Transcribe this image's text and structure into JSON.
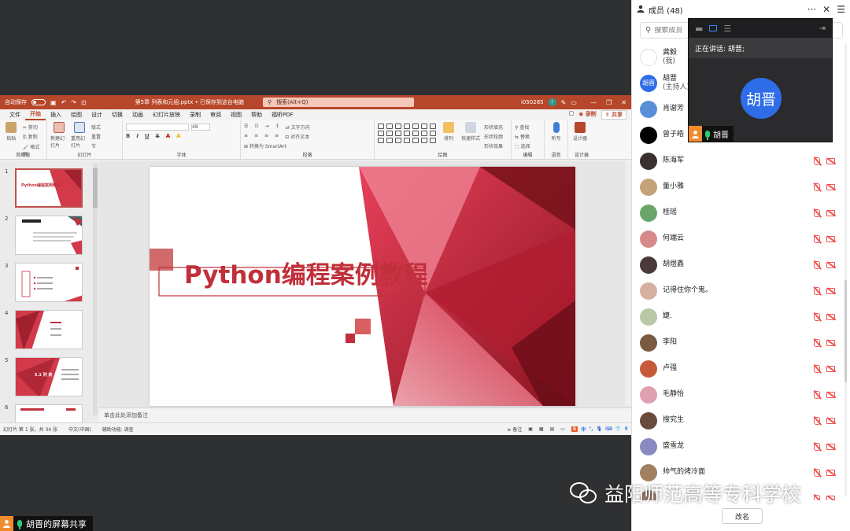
{
  "ppt": {
    "autosave": "自动保存",
    "filename": "第5章 列表和元组.pptx • 已保存到这台电脑",
    "search": "搜索(Alt+Q)",
    "user": "i050285",
    "menu": [
      "文件",
      "开始",
      "插入",
      "绘图",
      "设计",
      "切换",
      "动画",
      "幻灯片放映",
      "录制",
      "审阅",
      "视图",
      "帮助",
      "福昕PDF"
    ],
    "active_tab": "开始",
    "record": "录制",
    "share": "共享",
    "ribbon_groups": [
      "剪贴板",
      "幻灯片",
      "字体",
      "段落",
      "绘图",
      "编辑",
      "语音",
      "设计器"
    ],
    "ribbon_items": {
      "paste": "粘贴",
      "cut": "剪切",
      "copy": "复制",
      "format_painter": "格式刷",
      "new_slide": "新建幻灯片",
      "reuse_slide": "重用幻灯片",
      "layout": "版式",
      "reset": "重置",
      "section": "节",
      "text_direction": "文字方向",
      "align_text": "对齐文本",
      "smartart": "转换为 SmartArt",
      "arrange": "排列",
      "quick_styles": "快速样式",
      "shape_fill": "形状填充",
      "shape_outline": "形状轮廓",
      "shape_effect": "形状效果",
      "find": "查找",
      "replace": "替换",
      "select": "选择",
      "dictate": "听写",
      "designer": "设计器"
    },
    "font_size": "48",
    "thumb_numbers": [
      "1",
      "2",
      "3",
      "4",
      "5",
      "6"
    ],
    "thumb_titles": [
      "Python编程案例教程",
      "",
      "",
      "",
      "5.1 列 表",
      ""
    ],
    "slide_title": "Python编程案例教程",
    "notes": "单击此处添加备注",
    "status": {
      "slide_info": "幻灯片 第 1 张，共 34 张",
      "lang": "中文(中国)",
      "accessibility": "辅助功能: 调查",
      "notes_btn": "备注",
      "ime_s": "S",
      "ime_text": "中"
    }
  },
  "screen_share_label": "胡晋的屏幕共享",
  "members": {
    "title": "成员 (48)",
    "search_placeholder": "搜索成员",
    "list": [
      {
        "name": "龚毅",
        "sub": "(我)",
        "avatar_color": "#ffffff",
        "avatar_text": "",
        "muted": false
      },
      {
        "name": "胡晋",
        "sub": "(主持人)",
        "avatar_color": "#2f6de8",
        "avatar_text": "胡晋",
        "muted": false
      },
      {
        "name": "肖谢芳",
        "sub": "",
        "avatar_color": "#5a8fd8",
        "avatar_text": "",
        "muted": false
      },
      {
        "name": "曾子皓",
        "sub": "",
        "avatar_color": "#000000",
        "avatar_text": "",
        "muted": false
      },
      {
        "name": "陈海军",
        "sub": "",
        "avatar_color": "#3b3030",
        "avatar_text": "",
        "muted": true
      },
      {
        "name": "董小雅",
        "sub": "",
        "avatar_color": "#c4a27a",
        "avatar_text": "",
        "muted": true
      },
      {
        "name": "桂瑶",
        "sub": "",
        "avatar_color": "#6aa56a",
        "avatar_text": "",
        "muted": true
      },
      {
        "name": "何端云",
        "sub": "",
        "avatar_color": "#d88a8a",
        "avatar_text": "",
        "muted": true
      },
      {
        "name": "胡煜鑫",
        "sub": "",
        "avatar_color": "#4a3a3a",
        "avatar_text": "",
        "muted": true
      },
      {
        "name": "记得住你个鬼。",
        "sub": "",
        "avatar_color": "#d6b0a0",
        "avatar_text": "",
        "muted": true
      },
      {
        "name": "婕.",
        "sub": "",
        "avatar_color": "#b9c9a8",
        "avatar_text": "",
        "muted": true
      },
      {
        "name": "李阳",
        "sub": "",
        "avatar_color": "#7a5a40",
        "avatar_text": "",
        "muted": true
      },
      {
        "name": "卢强",
        "sub": "",
        "avatar_color": "#c55a3a",
        "avatar_text": "",
        "muted": true
      },
      {
        "name": "毛静怡",
        "sub": "",
        "avatar_color": "#e0a0b0",
        "avatar_text": "",
        "muted": true
      },
      {
        "name": "搜究生",
        "sub": "",
        "avatar_color": "#6a4a3a",
        "avatar_text": "",
        "muted": true
      },
      {
        "name": "盛雪龙",
        "sub": "",
        "avatar_color": "#8a8ac0",
        "avatar_text": "",
        "muted": true
      },
      {
        "name": "帅气的烤冷面",
        "sub": "",
        "avatar_color": "#a08060",
        "avatar_text": "",
        "muted": true
      },
      {
        "name": "",
        "sub": "",
        "avatar_color": "#9a7a6a",
        "avatar_text": "",
        "muted": true
      }
    ],
    "rename": "改名"
  },
  "speaker": {
    "talking": "正在讲话: 胡晋;",
    "avatar_text": "胡晋",
    "name": "胡晋"
  },
  "watermark": "益阳师范高等专科学校"
}
